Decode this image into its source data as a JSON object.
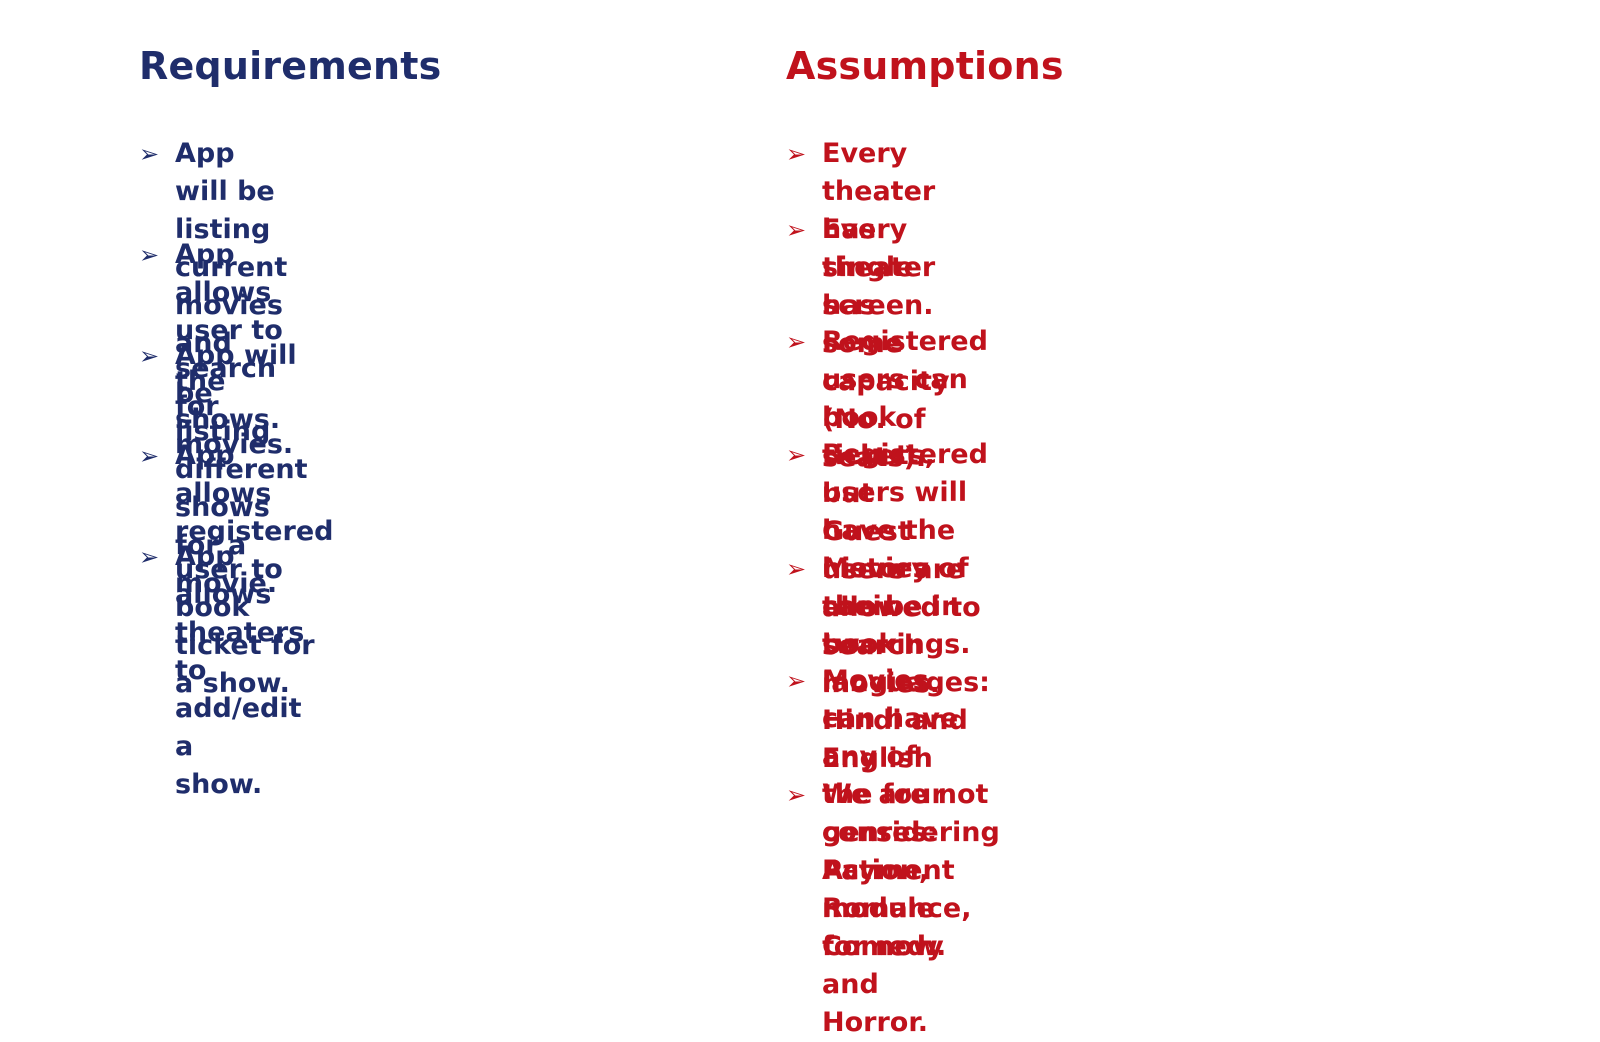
{
  "requirements": {
    "title": "Requirements",
    "color": "#1f2d6b",
    "items": [
      {
        "text": "App will be listing current movies\nand the shows."
      },
      {
        "text": "App allows user to search for\nmovies."
      },
      {
        "text": "App will be listing different shows\nfor a movie."
      },
      {
        "text": "App allows registered user to book\nticket for a show."
      },
      {
        "text": "App allows theaters to add/edit a\nshow."
      }
    ]
  },
  "assumptions": {
    "title": "Assumptions",
    "color": "#c0121c",
    "items": [
      {
        "text": "Every theater has single screen."
      },
      {
        "text": "Every theater has some capacity (No. of\nseats)."
      },
      {
        "text": "Registered users can book tickets, but\nGuest users are allowed to search movies."
      },
      {
        "text": "Registered users will have the history of\ntheir bookings."
      },
      {
        "text": "Movies can be in two languages: Hindi and\nEnglish"
      },
      {
        "text": "Movies can have any of the four genres:\nAction, Romance, Comedy and Horror."
      },
      {
        "text": "We are not considering Payment module\nfor now."
      }
    ]
  },
  "icons": {
    "bullet": "arrowhead-bullet-icon",
    "bullet_glyph": "➢"
  }
}
